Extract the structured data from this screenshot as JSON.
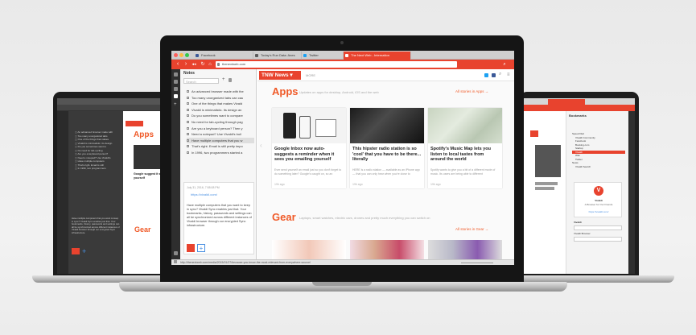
{
  "browser": {
    "tabs": [
      {
        "label": "Facebook",
        "color": "#3b5998"
      },
      {
        "label": "Today's Run Data: Anes",
        "color": "#5a5a5a"
      },
      {
        "label": "Twitter",
        "color": "#1da1f2"
      },
      {
        "label": "The Next Web - Internation",
        "color": "#ffffff"
      }
    ],
    "url": "thenextweb.com",
    "status_text": "http://thenextweb.com/media/2015/01/27/because-you-know-the-most-relevant-from-everywhere-source/",
    "accent": "#e8432e"
  },
  "notes_panel": {
    "title": "Notes",
    "search_placeholder": "Search",
    "items": [
      "An advanced browser made with the",
      "Too many unorganized tabs can cau",
      "One of the things that makes Vivald",
      "Vivaldi is minimalistic. Its design an",
      "Do you sometimes want to compare",
      "No need for tab-cycling through pag",
      "Are you a keyboard person? Then y",
      "Need a notepad? Use Vivaldi's buil",
      "Have multiple computers that you w",
      "That's right. Email is still pretty impo",
      "In 1996, two programmers started a"
    ],
    "detail_date": "July 31, 2016, 7:58:08 PM",
    "detail_link": "https://vivaldi.com/",
    "detail_text": "Have multiple computers that you want to keep in sync? Vivaldi Sync enables just that. Your bookmarks, history, passwords and settings can all be synchronized across different instances of Vivaldi browser through our encrypted Sync infrastructure."
  },
  "site": {
    "logo": "TNW News ▾",
    "menu": "MORE",
    "apps_title": "Apps",
    "apps_sub": "Updates on apps for desktop, Android, iOS and the web",
    "apps_all": "All stories in Apps →",
    "cards": [
      {
        "headline": "Google Inbox now auto-suggests a reminder when it sees you emailing yourself",
        "desc": "Ever send yourself an email just so you don't forget to do something later? Google's caught on, so an",
        "age": "19h ago"
      },
      {
        "headline": "This hipster radio station is so 'cool' that you have to be there... literally",
        "desc": "HERE is a radio station — available as an iPhone app — that you can only hear when you're close to",
        "age": "19h ago"
      },
      {
        "headline": "Spotify's Music Map lets you listen to local tastes from around the world",
        "desc": "Spotify wants to give you a bit of a different mode of music. Its users are being able to different",
        "age": "19h ago"
      }
    ],
    "gear_title": "Gear",
    "gear_sub": "Laptops, smart watches, electric cars, drones and pretty much everything you can switch on",
    "gear_all": "All stories in Gear →"
  },
  "left_laptop": {
    "apps_title": "Apps",
    "gear_title": "Gear",
    "card_headline": "Google suggest it sees yourself",
    "note_text": "Have multiple computers that you want to keep in sync? Vivaldi Sync enables just that. Your bookmarks, history, passwords and settings can all be synchronized across different instances of Vivaldi browser through our encrypted Sync infrastructure."
  },
  "right_laptop": {
    "panel_title": "Bookmarks",
    "folders": [
      "Speed Dial",
      "Vivaldi Community",
      "Facebook",
      "Booking.com",
      "Startup",
      "Vivaldi",
      "Wiki",
      "Twitter",
      "News",
      "Vivaldi Search"
    ],
    "card_title": "Vivaldi",
    "card_desc": "A Browser for Our Friends",
    "card_url": "https://vivaldi.com/",
    "field_label": "Vivaldi",
    "field_label2": "Vivaldi Browser"
  }
}
